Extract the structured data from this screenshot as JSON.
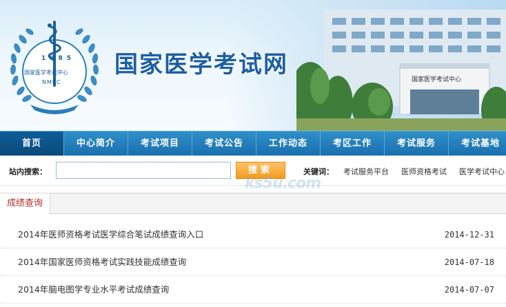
{
  "header": {
    "site_title": "国家医学考试网",
    "emblem": {
      "year": "1985",
      "org_name": "国家医学考试中心",
      "abbr": "NMEC"
    },
    "building_sign": "国家医学考试中心"
  },
  "nav": {
    "items": [
      {
        "label": "首页",
        "active": true
      },
      {
        "label": "中心简介"
      },
      {
        "label": "考试项目"
      },
      {
        "label": "考试公告"
      },
      {
        "label": "工作动态"
      },
      {
        "label": "考区工作"
      },
      {
        "label": "考试服务"
      },
      {
        "label": "考试基地"
      }
    ]
  },
  "search": {
    "label": "站内搜索：",
    "value": "",
    "button_label": "搜索",
    "keywords_label": "关键词：",
    "keywords": [
      "考试服务平台",
      "医师资格考试",
      "医学考试中心"
    ]
  },
  "watermark": "ks5u.com",
  "section": {
    "tab_label": "成绩查询",
    "items": [
      {
        "title": "2014年医师资格考试医学综合笔试成绩查询入口",
        "date": "2014-12-31"
      },
      {
        "title": "2014年国家医师资格考试实践技能成绩查询",
        "date": "2014-07-18"
      },
      {
        "title": "2014年脑电图学专业水平考试成绩查询",
        "date": "2014-07-07"
      }
    ]
  },
  "colors": {
    "nav_bg": "#1a6fae",
    "nav_active": "#0a4a7c",
    "title_blue": "#1b5fa3",
    "search_button": "#f39a1f",
    "tab_text": "#b22a2a"
  }
}
